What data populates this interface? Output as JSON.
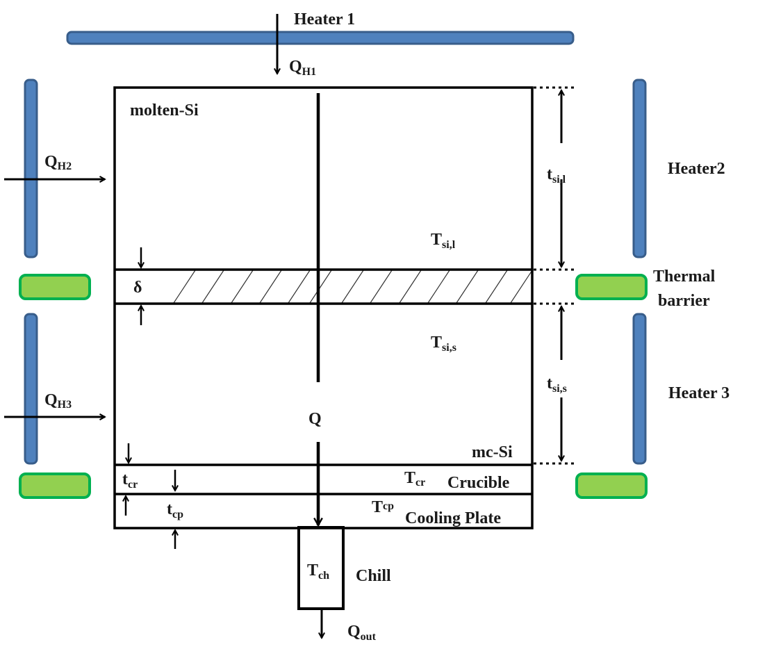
{
  "diagram": {
    "heaters": {
      "heater1": "Heater 1",
      "heater2": "Heater2",
      "heater3": "Heater 3"
    },
    "barrier_label": [
      "Thermal",
      "barrier"
    ],
    "regions": {
      "molten": "molten-Si",
      "mc": "mc-Si",
      "crucible": "Crucible",
      "cooling_plate": "Cooling Plate",
      "chill": "Chill"
    },
    "heat_flows": {
      "qh1": {
        "main": "Q",
        "sub": "H1"
      },
      "qh2": {
        "main": "Q",
        "sub": "H2"
      },
      "qh3": {
        "main": "Q",
        "sub": "H3"
      },
      "q": {
        "main": "Q"
      },
      "qout": {
        "main": "Q",
        "sub": "out"
      }
    },
    "temperatures": {
      "tsil": {
        "main": "T",
        "sub": "si,l"
      },
      "tsis": {
        "main": "T",
        "sub": "si,s"
      },
      "tcr": {
        "main": "T",
        "sub": "cr"
      },
      "tcp": {
        "main": "T",
        "sub": "cp"
      },
      "tch": {
        "main": "T",
        "sub": "ch"
      }
    },
    "thicknesses": {
      "delta": "δ",
      "tsil": {
        "main": "t",
        "sub": "si,l"
      },
      "tsis": {
        "main": "t",
        "sub": "si,s"
      },
      "tcr": {
        "main": "t",
        "sub": "cr"
      },
      "tcp": {
        "main": "t",
        "sub": "cp"
      }
    },
    "colors": {
      "heater_fill": "#4f81bd",
      "heater_stroke": "#385d8a",
      "barrier_fill": "#92d050",
      "barrier_stroke": "#00b050"
    }
  }
}
